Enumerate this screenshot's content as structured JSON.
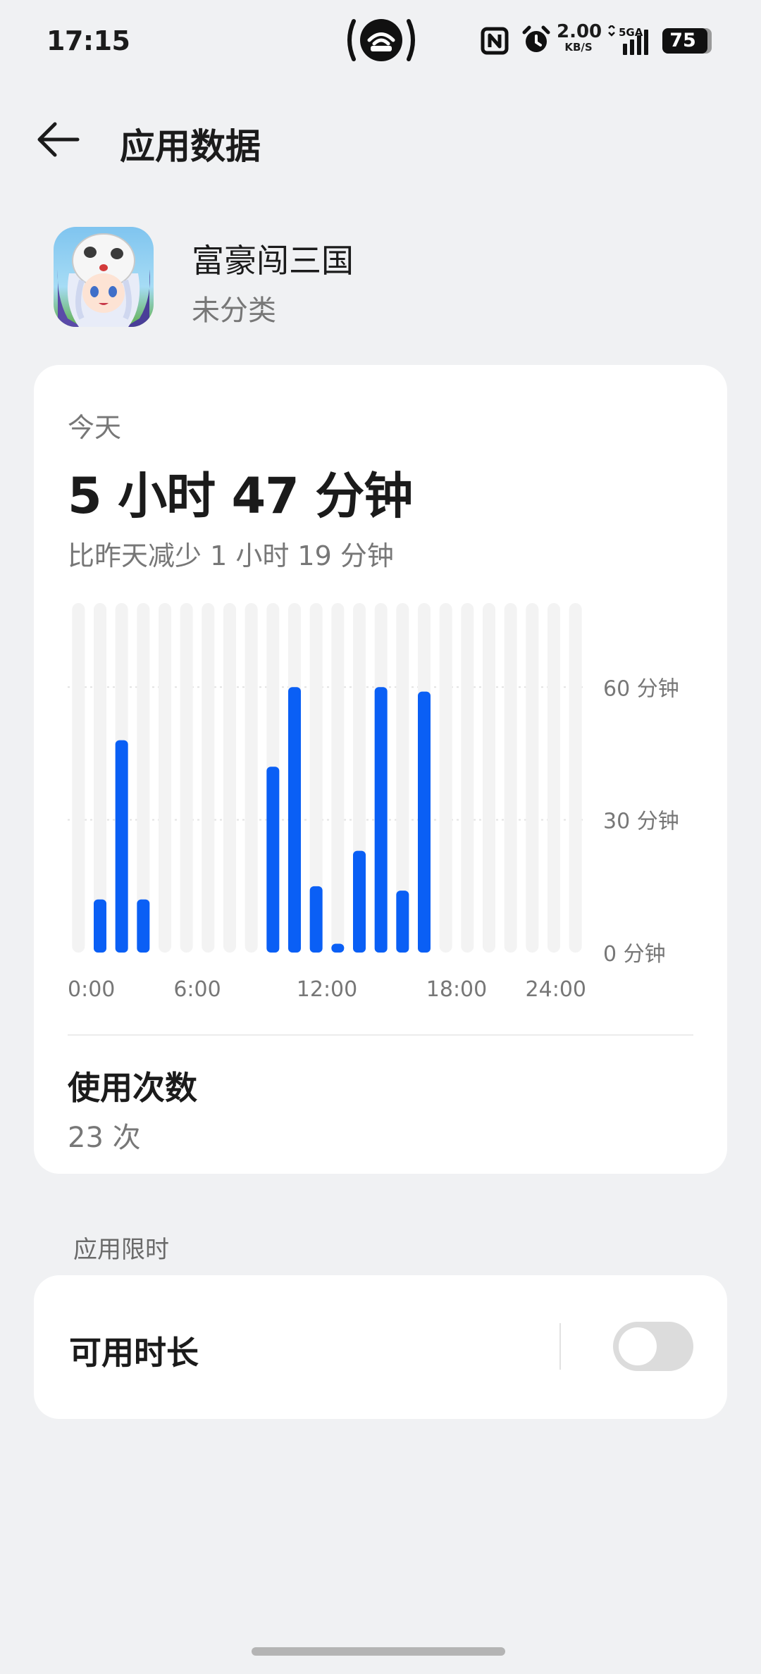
{
  "status_bar": {
    "time": "17:15",
    "net_speed": "2.00",
    "net_speed_unit": "KB/S",
    "network_type": "5GA",
    "battery": "75",
    "icons": [
      "hotspot-icon",
      "nfc-icon",
      "alarm-icon",
      "signal-icon",
      "battery-icon"
    ]
  },
  "header": {
    "title": "应用数据",
    "back_icon": "arrow-left-icon"
  },
  "app": {
    "name": "富豪闯三国",
    "category": "未分类"
  },
  "usage": {
    "period_label": "今天",
    "total_time": "5 小时 47 分钟",
    "comparison": "比昨天减少 1 小时 19 分钟",
    "count_label": "使用次数",
    "count_value": "23 次"
  },
  "chart_data": {
    "type": "bar",
    "categories": [
      "0",
      "1",
      "2",
      "3",
      "4",
      "5",
      "6",
      "7",
      "8",
      "9",
      "10",
      "11",
      "12",
      "13",
      "14",
      "15",
      "16",
      "17",
      "18",
      "19",
      "20",
      "21",
      "22",
      "23"
    ],
    "values": [
      0,
      12,
      48,
      12,
      0,
      0,
      0,
      0,
      0,
      42,
      60,
      15,
      2,
      23,
      60,
      14,
      59,
      0,
      0,
      0,
      0,
      0,
      0,
      0
    ],
    "x_tick_labels": [
      "0:00",
      "6:00",
      "12:00",
      "18:00",
      "24:00"
    ],
    "y_tick_labels": [
      "0 分钟",
      "30 分钟",
      "60 分钟"
    ],
    "y_ticks": [
      0,
      30,
      60
    ],
    "ylim": [
      0,
      79
    ],
    "bar_color": "#0a5ff5",
    "track_color": "#f3f3f3",
    "grid": true
  },
  "limit": {
    "section_label": "应用限时",
    "item_label": "可用时长",
    "enabled": false
  },
  "colors": {
    "accent": "#0a5ff5",
    "background": "#f0f1f3",
    "card": "#ffffff"
  }
}
